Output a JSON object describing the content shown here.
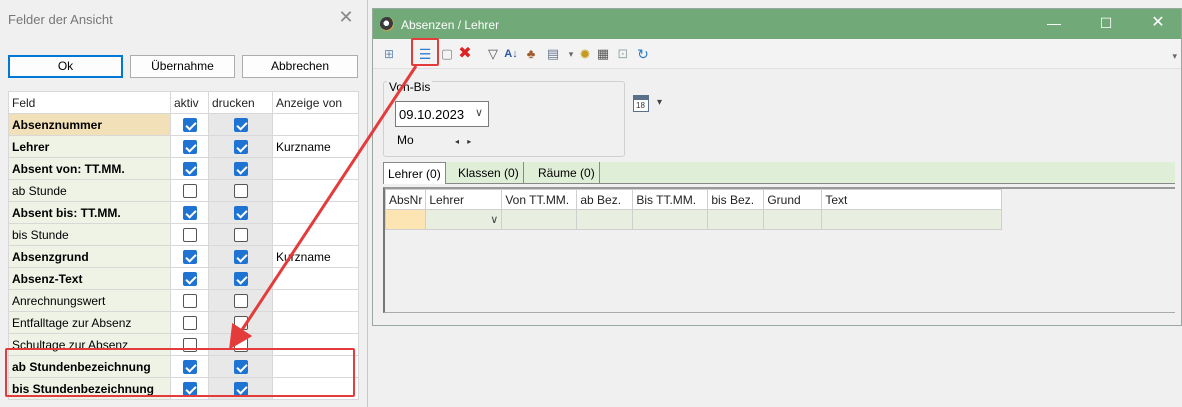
{
  "dialog": {
    "title": "Felder der Ansicht",
    "buttons": {
      "ok": "Ok",
      "uebernahme": "Übernahme",
      "abbrechen": "Abbrechen"
    },
    "columns": [
      "Feld",
      "aktiv",
      "drucken",
      "Anzeige von"
    ],
    "rows": [
      {
        "feld": "Absenznummer",
        "aktiv": true,
        "drucken": true,
        "anzeige": "",
        "bold": true
      },
      {
        "feld": "Lehrer",
        "aktiv": true,
        "drucken": true,
        "anzeige": "Kurzname",
        "bold": true
      },
      {
        "feld": "Absent von: TT.MM.",
        "aktiv": true,
        "drucken": true,
        "anzeige": "",
        "bold": true
      },
      {
        "feld": "ab Stunde",
        "aktiv": false,
        "drucken": false,
        "anzeige": "",
        "bold": false
      },
      {
        "feld": "Absent bis: TT.MM.",
        "aktiv": true,
        "drucken": true,
        "anzeige": "",
        "bold": true
      },
      {
        "feld": "bis Stunde",
        "aktiv": false,
        "drucken": false,
        "anzeige": "",
        "bold": false
      },
      {
        "feld": "Absenzgrund",
        "aktiv": true,
        "drucken": true,
        "anzeige": "Kurzname",
        "bold": true
      },
      {
        "feld": "Absenz-Text",
        "aktiv": true,
        "drucken": true,
        "anzeige": "",
        "bold": true
      },
      {
        "feld": "Anrechnungswert",
        "aktiv": false,
        "drucken": false,
        "anzeige": "",
        "bold": false
      },
      {
        "feld": "Entfalltage zur Absenz",
        "aktiv": false,
        "drucken": false,
        "anzeige": "",
        "bold": false
      },
      {
        "feld": "Schultage zur Absenz",
        "aktiv": false,
        "drucken": false,
        "anzeige": "",
        "bold": false
      },
      {
        "feld": "ab Stundenbezeichnung",
        "aktiv": true,
        "drucken": true,
        "anzeige": "",
        "bold": true
      },
      {
        "feld": "bis Stundenbezeichnung",
        "aktiv": true,
        "drucken": true,
        "anzeige": "",
        "bold": true
      }
    ]
  },
  "window": {
    "title": "Absenzen / Lehrer",
    "controls": {
      "minimize": "—",
      "maximize": "☐",
      "close": "✕"
    },
    "filter": {
      "legend": "Von-Bis",
      "date": "09.10.2023",
      "weekday": "Mo",
      "stepper": "◂ ▸"
    },
    "calendar_number": "18",
    "tabs": [
      "Lehrer (0)",
      "Klassen (0)",
      "Räume (0)"
    ],
    "grid_columns": [
      "AbsNr",
      "Lehrer",
      "Von TT.MM.",
      "ab Bez.",
      "Bis TT.MM.",
      "bis Bez.",
      "Grund",
      "Text"
    ],
    "toolbar_icons": [
      "grid-icon",
      "field-list-icon",
      "new-icon",
      "delete-icon",
      "filter-icon",
      "sort-icon",
      "teachers-icon",
      "print-icon",
      "settings-icon",
      "calendar-icon",
      "window-icon",
      "refresh-icon"
    ]
  },
  "colors": {
    "titlebar": "#71a979",
    "highlight": "#e43b3b",
    "checkbox_on": "#1f73d2",
    "field_bg": "#eef3e6"
  }
}
